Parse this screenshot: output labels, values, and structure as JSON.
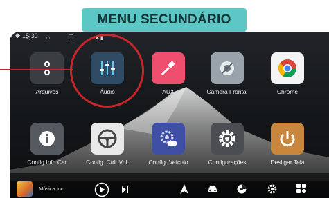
{
  "banner": {
    "title": "MENU SECUNDÁRIO"
  },
  "status_bar": {
    "time": "15:30"
  },
  "apps_row1": [
    {
      "label": "Arquivos",
      "icon": "files-icon",
      "color": "#3a3d42"
    },
    {
      "label": "Áudio",
      "icon": "equalizer-icon",
      "color": "#2f4a63"
    },
    {
      "label": "AUX",
      "icon": "aux-cable-icon",
      "color": "#ee4f6f"
    },
    {
      "label": "Câmera Frontal",
      "icon": "camera-icon",
      "color": "#9aa3ab"
    },
    {
      "label": "Chrome",
      "icon": "chrome-icon",
      "color": "#f4f4f4"
    }
  ],
  "apps_row2": [
    {
      "label": "Config Info Car",
      "icon": "info-icon",
      "color": "#555a60"
    },
    {
      "label": "Config. Ctrl. Vol.",
      "icon": "steering-wheel-icon",
      "color": "#e9e9e9"
    },
    {
      "label": "Config. Veículo",
      "icon": "vehicle-settings-icon",
      "color": "#3f4fa3"
    },
    {
      "label": "Configurações",
      "icon": "gear-icon",
      "color": "#4a4d52"
    },
    {
      "label": "Desligar Tela",
      "icon": "power-icon",
      "color": "#c9873e"
    }
  ],
  "dock": {
    "track_title": "Música loc"
  },
  "accent": "#c6272b"
}
